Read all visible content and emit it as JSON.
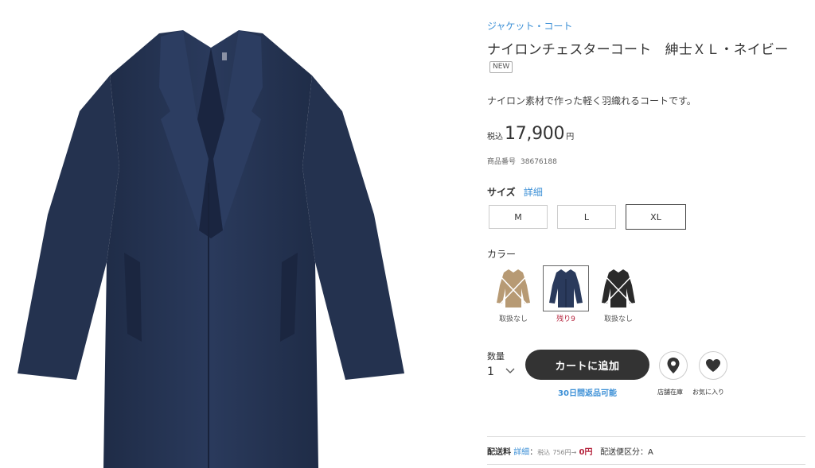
{
  "product": {
    "category": "ジャケット・コート",
    "title": "ナイロンチェスターコート　紳士ＸＬ・ネイビー",
    "badge": "NEW",
    "description": "ナイロン素材で作った軽く羽織れるコートです。",
    "price": {
      "tax_label": "税込",
      "amount": "17,900",
      "currency": "円"
    },
    "code_label": "商品番号",
    "code": "38676188"
  },
  "size": {
    "label": "サイズ",
    "detail_link": "詳細",
    "options": [
      "M",
      "L",
      "XL"
    ],
    "selected": "XL"
  },
  "color": {
    "label": "カラー",
    "options": [
      {
        "name": "beige",
        "status": "取扱なし",
        "swatch_color": "#b79a74",
        "crossed": true
      },
      {
        "name": "navy",
        "status": "残り9",
        "swatch_color": "#2a3a5c",
        "crossed": false
      },
      {
        "name": "black",
        "status": "取扱なし",
        "swatch_color": "#2a2a2a",
        "crossed": true
      }
    ],
    "selected": "navy"
  },
  "quantity": {
    "label": "数量",
    "value": "1"
  },
  "cart": {
    "add_label": "カートに追加",
    "returns_note": "30日間返品可能",
    "store_stock_label": "店舗在庫",
    "favorite_label": "お気に入り"
  },
  "shipping": {
    "label": "配送料",
    "detail_link": "詳細",
    "sep": "：",
    "original_tax_label": "税込",
    "original_price": "756円→",
    "final_price": "0円",
    "class_label": "配送便区分：A"
  },
  "icons": {
    "store": "map-pin-icon",
    "favorite": "heart-icon",
    "dropdown": "chevron-down-icon"
  },
  "colors": {
    "accent_blue": "#3b8fd6",
    "cart_button": "#333333",
    "stock_red": "#b5233c",
    "coat_navy": "#263552"
  }
}
